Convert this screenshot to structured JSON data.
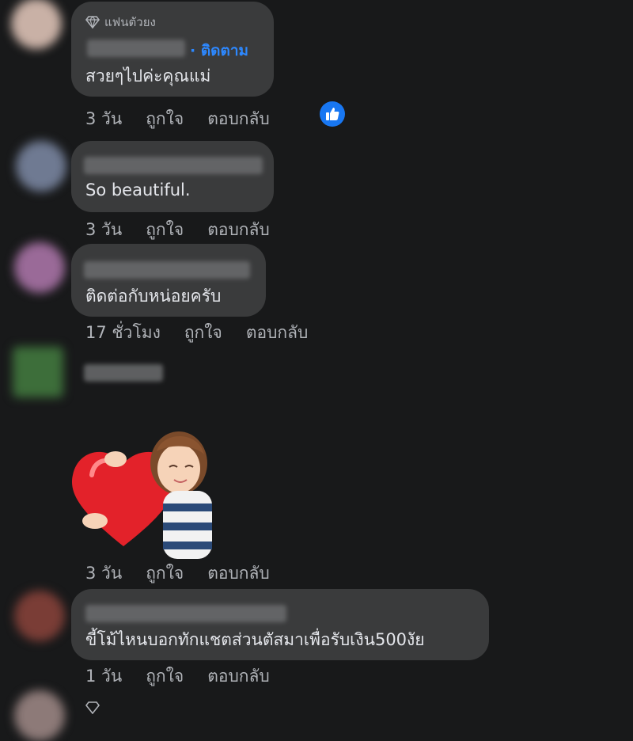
{
  "comments": [
    {
      "badge": "แฟนตัวยง",
      "follow": "· ติดตาม",
      "text": "สวยๆไปค่ะคุณแม่",
      "time": "3 วัน",
      "like": "ถูกใจ",
      "reply": "ตอบกลับ",
      "reaction": "like-icon"
    },
    {
      "text": "So beautiful.",
      "time": "3 วัน",
      "like": "ถูกใจ",
      "reply": "ตอบกลับ"
    },
    {
      "text": "ติดต่อกับหน่อยครับ",
      "time": "17 ชั่วโมง",
      "like": "ถูกใจ",
      "reply": "ตอบกลับ"
    },
    {
      "sticker": "heart-hug-sticker",
      "time": "3 วัน",
      "like": "ถูกใจ",
      "reply": "ตอบกลับ"
    },
    {
      "text": "ขี้โม้ไหนบอกทักแชตส่วนตัสมาเพื่อรับเงิน500งัย",
      "time": "1 วัน",
      "like": "ถูกใจ",
      "reply": "ตอบกลับ"
    }
  ],
  "colors": {
    "background": "#18191a",
    "bubble": "#3a3b3c",
    "link": "#2d88ff",
    "like": "#1877f2"
  }
}
